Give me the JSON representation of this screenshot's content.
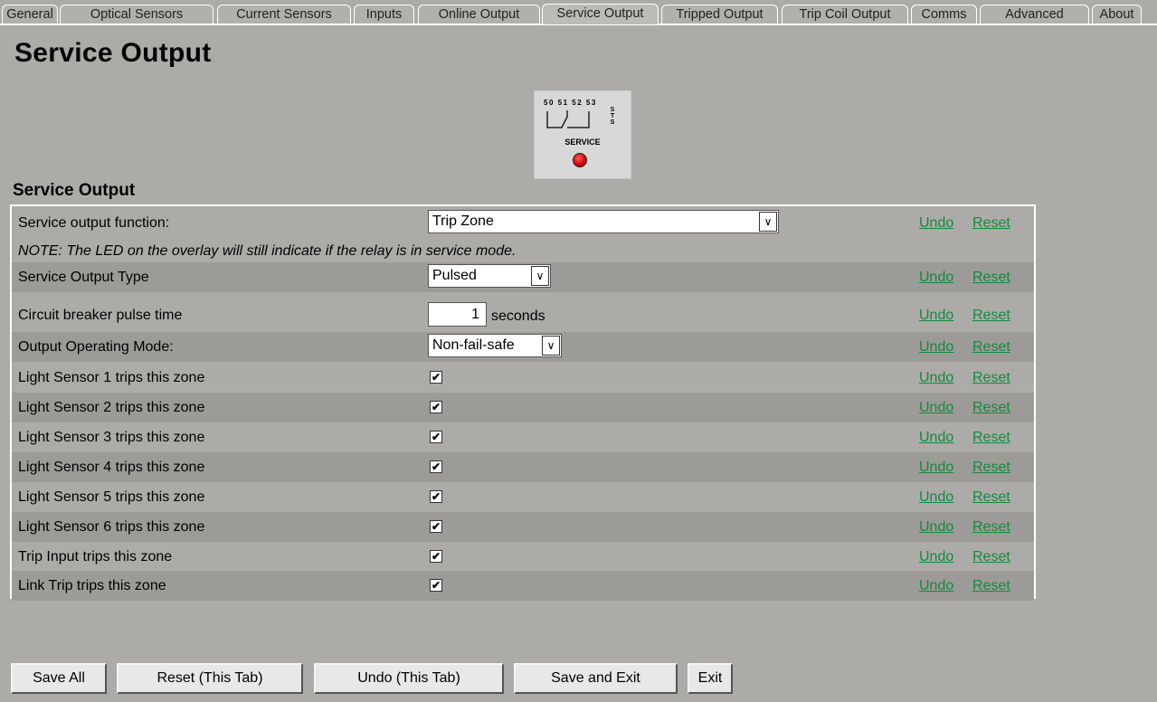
{
  "tabs": [
    {
      "label": "General"
    },
    {
      "label": "Optical Sensors"
    },
    {
      "label": "Current Sensors"
    },
    {
      "label": "Inputs"
    },
    {
      "label": "Online Output"
    },
    {
      "label": "Service Output",
      "active": true
    },
    {
      "label": "Tripped Output"
    },
    {
      "label": "Trip Coil Output"
    },
    {
      "label": "Comms"
    },
    {
      "label": "Advanced"
    },
    {
      "label": "About"
    }
  ],
  "page_title": "Service Output",
  "service_image": {
    "terminals": "50 51 52 53",
    "sts": "S T S",
    "label": "SERVICE",
    "led_color": "#d40000"
  },
  "section_title": "Service Output",
  "note": "NOTE: The LED on the overlay will still indicate if the relay is in service mode.",
  "undo_label": "Undo",
  "reset_label": "Reset",
  "rows": {
    "function": {
      "label": "Service output function:",
      "value": "Trip Zone"
    },
    "type": {
      "label": "Service Output Type",
      "value": "Pulsed"
    },
    "pulse": {
      "label": "Circuit breaker pulse time",
      "value": "1",
      "unit": "seconds"
    },
    "mode": {
      "label": "Output Operating Mode:",
      "value": "Non-fail-safe"
    },
    "checks": [
      {
        "label": "Light Sensor 1 trips this zone",
        "checked": true
      },
      {
        "label": "Light Sensor 2 trips this zone",
        "checked": true
      },
      {
        "label": "Light Sensor 3 trips this zone",
        "checked": true
      },
      {
        "label": "Light Sensor 4 trips this zone",
        "checked": true
      },
      {
        "label": "Light Sensor 5 trips this zone",
        "checked": true
      },
      {
        "label": "Light Sensor 6 trips this zone",
        "checked": true
      },
      {
        "label": "Trip Input trips this zone",
        "checked": true
      },
      {
        "label": "Link Trip trips this zone",
        "checked": true
      }
    ]
  },
  "buttons": {
    "save_all": "Save All",
    "reset_tab": "Reset (This Tab)",
    "undo_tab": "Undo (This Tab)",
    "save_exit": "Save and Exit",
    "exit": "Exit"
  },
  "colors": {
    "background": "#adaba8",
    "link": "#128a3c",
    "alt_row": "#9d9b98"
  }
}
